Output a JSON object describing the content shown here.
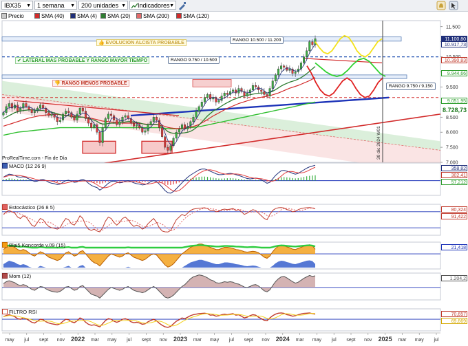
{
  "toolbar": {
    "symbol": "IBX35",
    "interval": "1 semana",
    "units": "200 unidades",
    "indicators": "Indicadores",
    "arrow_down": "▼",
    "trend_icon": "trend-icon",
    "draw_icon": "draw-icon",
    "cursor_icon": "cursor-icon",
    "alert_icon": "bell-icon"
  },
  "legend": [
    {
      "label": "Precio",
      "color": "#c8c8c8"
    },
    {
      "label": "SMA (40)",
      "color": "#d22b2b"
    },
    {
      "label": "SMA (4)",
      "color": "#1f2f7a"
    },
    {
      "label": "SMA (20)",
      "color": "#2f7d32"
    },
    {
      "label": "SMA (200)",
      "color": "#e36b6b"
    },
    {
      "label": "SMA (120)",
      "color": "#d22b2b"
    }
  ],
  "annotations": {
    "bull": "EVOLUCION ALCISTA PROBABLE",
    "lateral": "LATERAL MAS PROBABLE Y RANGO MAYOR TIEMPO",
    "bear": "RANGO MENOS PROBABLE",
    "range1": "RANGO 10.500 / 11.200",
    "range2": "RANGO 9.750 / 10.500",
    "range3": "RANGO 9.750 / 9.150",
    "vline_date": "30 dic 2024 W01",
    "source": "ProRealTime.com - Fin de Día"
  },
  "chart_data": [
    {
      "type": "line",
      "name": "price",
      "ylim": [
        7000,
        11700
      ],
      "yticks": [
        "11.500",
        "11.000",
        "10.500",
        "10.000",
        "9.500",
        "9.000",
        "8.500",
        "8.000",
        "7.500",
        "7.000"
      ],
      "price_tags": [
        {
          "label": "11.100,80",
          "value": 11100,
          "bg": "#1f2f7a",
          "fg": "#ffffff"
        },
        {
          "label": "10.917,73",
          "value": 10917,
          "bg": "#ffffff",
          "fg": "#1f2f7a"
        },
        {
          "label": "10.390,83",
          "value": 10390,
          "bg": "#ffffff",
          "fg": "#c0392b"
        },
        {
          "label": "9.944,66",
          "value": 9944,
          "bg": "#ffffff",
          "fg": "#2e9e2e"
        },
        {
          "label": "9.051,95",
          "value": 9051,
          "bg": "#ffffff",
          "fg": "#2e9e2e"
        },
        {
          "label": "8.728,73",
          "value": 8728,
          "bg": "#ffffff",
          "fg": "#1f7a1f"
        }
      ],
      "x_labels": [
        "may",
        "jul",
        "sept",
        "nov",
        "2022",
        "mar",
        "may",
        "jul",
        "sept",
        "nov",
        "2023",
        "mar",
        "may",
        "jul",
        "sept",
        "nov",
        "2024",
        "mar",
        "may",
        "jul",
        "sept",
        "nov",
        "2025",
        "mar",
        "may",
        "jul"
      ],
      "close": [
        8650,
        8850,
        8950,
        8800,
        8900,
        8700,
        8800,
        8950,
        8850,
        8750,
        8650,
        8700,
        8800,
        8900,
        8800,
        8650,
        8550,
        8600,
        8500,
        8350,
        8400,
        8600,
        8700,
        8650,
        8500,
        8400,
        8600,
        8800,
        8700,
        8450,
        8300,
        8150,
        8250,
        8000,
        7650,
        8150,
        8450,
        8600,
        8550,
        8400,
        8250,
        8350,
        8500,
        8550,
        8450,
        8300,
        8200,
        8250,
        8150,
        8000,
        8050,
        8250,
        8350,
        8500,
        8400,
        8150,
        7850,
        7500,
        7400,
        7550,
        7800,
        8000,
        8100,
        8250,
        8100,
        8200,
        8350,
        8500,
        8700,
        8850,
        9000,
        9150,
        9250,
        9100,
        9150,
        9000,
        9050,
        9200,
        9300,
        9250,
        9350,
        9400,
        9300,
        9450,
        9350,
        9200,
        9300,
        9400,
        9550,
        9500,
        9400,
        9350,
        9250,
        9200,
        9450,
        9700,
        9900,
        10100,
        10200,
        10150,
        10050,
        10100,
        9950,
        10000,
        10100,
        10300,
        10500,
        10700,
        11000,
        10900,
        11100
      ],
      "sma20": [
        8450,
        8500,
        8550,
        8600,
        8650,
        8680,
        8700,
        8720,
        8730,
        8740,
        8740,
        8730,
        8720,
        8720,
        8720,
        8700,
        8680,
        8660,
        8640,
        8610,
        8580,
        8560,
        8550,
        8540,
        8520,
        8500,
        8500,
        8500,
        8500,
        8480,
        8450,
        8420,
        8400,
        8360,
        8300,
        8270,
        8270,
        8290,
        8300,
        8300,
        8300,
        8310,
        8320,
        8340,
        8350,
        8350,
        8340,
        8330,
        8310,
        8280,
        8260,
        8250,
        8250,
        8260,
        8260,
        8230,
        8180,
        8100,
        8020,
        7980,
        7960,
        7950,
        7950,
        7970,
        7980,
        8000,
        8030,
        8080,
        8150,
        8240,
        8340,
        8440,
        8540,
        8620,
        8700,
        8760,
        8810,
        8870,
        8930,
        8980,
        9030,
        9080,
        9110,
        9150,
        9180,
        9200,
        9220,
        9240,
        9260,
        9280,
        9290,
        9300,
        9300,
        9300,
        9320,
        9360,
        9410,
        9470,
        9530,
        9580,
        9620,
        9660,
        9690,
        9720,
        9760,
        9810,
        9870,
        9940,
        10020,
        10100,
        10180
      ],
      "sma40": [
        8200,
        8230,
        8260,
        8290,
        8320,
        8350,
        8380,
        8410,
        8440,
        8470,
        8490,
        8510,
        8530,
        8550,
        8560,
        8570,
        8580,
        8590,
        8590,
        8590,
        8580,
        8570,
        8560,
        8550,
        8540,
        8530,
        8520,
        8510,
        8500,
        8490,
        8480,
        8460,
        8440,
        8420,
        8390,
        8370,
        8360,
        8350,
        8340,
        8330,
        8320,
        8310,
        8300,
        8300,
        8300,
        8300,
        8300,
        8300,
        8290,
        8280,
        8270,
        8260,
        8250,
        8250,
        8250,
        8240,
        8220,
        8190,
        8160,
        8140,
        8130,
        8120,
        8120,
        8130,
        8140,
        8150,
        8170,
        8190,
        8220,
        8260,
        8310,
        8360,
        8420,
        8480,
        8540,
        8590,
        8640,
        8690,
        8740,
        8790,
        8830,
        8870,
        8910,
        8950,
        8980,
        9010,
        9040,
        9070,
        9100,
        9120,
        9140,
        9160,
        9180,
        9190,
        9210,
        9240,
        9270,
        9300,
        9340,
        9380,
        9420,
        9460,
        9490,
        9520,
        9550,
        9590,
        9630,
        9670,
        9710,
        9760,
        9810
      ],
      "sma120": [
        7900,
        7920,
        7940,
        7960,
        7980,
        8000,
        8010,
        8020,
        8030,
        8040,
        8050,
        8060,
        8070,
        8080,
        8090,
        8100,
        8110,
        8120,
        8130,
        8140,
        8150,
        8150,
        8150,
        8150,
        8150,
        8150,
        8150,
        8150,
        8150,
        8150,
        8150,
        8150,
        8150,
        8150,
        8150,
        8150,
        8150,
        8150,
        8150,
        8150,
        8150,
        8150,
        8150,
        8150,
        8150,
        8150,
        8150,
        8150,
        8150,
        8150,
        8150,
        8150,
        8150,
        8150,
        8150,
        8150,
        8140,
        8130,
        8120,
        8110,
        8110,
        8110,
        8110,
        8120,
        8130,
        8140,
        8150,
        8160,
        8170,
        8180,
        8200,
        8220,
        8240,
        8260,
        8280,
        8300,
        8320,
        8340,
        8360,
        8380,
        8400,
        8420,
        8440,
        8460,
        8480,
        8500,
        8520,
        8540,
        8560,
        8580,
        8600,
        8620,
        8640,
        8660,
        8680,
        8700,
        8720,
        8740,
        8760,
        8780,
        8800,
        8820,
        8840,
        8860,
        8880,
        8900,
        8920,
        8940,
        8960,
        8980,
        9000
      ],
      "proj_yellow": [
        11000,
        10800,
        10650,
        10600,
        10700,
        10900,
        11100,
        11200,
        11150,
        10950,
        10700,
        10550,
        10500,
        10600,
        10800,
        11000,
        11100
      ],
      "proj_green": [
        10300,
        10150,
        10000,
        9900,
        9850,
        9900,
        10050,
        10250,
        10400,
        10450,
        10350,
        10150,
        9950,
        9850
      ],
      "proj_red": [
        10200,
        9950,
        9650,
        9400,
        9250,
        9200,
        9300,
        9500,
        9700,
        9800,
        9700,
        9450,
        9250,
        9150,
        9200,
        9400,
        9650,
        9800
      ]
    },
    {
      "type": "line",
      "name": "MACD (12 26 9)",
      "tags": [
        "358,82",
        "302,41",
        "57,212"
      ],
      "values": [
        80,
        120,
        150,
        140,
        120,
        90,
        80,
        90,
        70,
        40,
        10,
        -20,
        -10,
        20,
        30,
        0,
        -40,
        -60,
        -70,
        -90,
        -80,
        -40,
        0,
        10,
        -10,
        -40,
        -30,
        10,
        30,
        0,
        -60,
        -110,
        -140,
        -160,
        -220,
        -180,
        -120,
        -60,
        -20,
        -10,
        -30,
        -50,
        -40,
        -10,
        0,
        -20,
        -50,
        -70,
        -80,
        -100,
        -90,
        -60,
        -20,
        0,
        -20,
        -80,
        -150,
        -230,
        -280,
        -290,
        -250,
        -190,
        -120,
        -50,
        20,
        80,
        130,
        170,
        210,
        250,
        270,
        270,
        250,
        220,
        190,
        160,
        140,
        140,
        150,
        160,
        170,
        160,
        140,
        120,
        100,
        70,
        50,
        40,
        50,
        60,
        50,
        20,
        -20,
        -60,
        -40,
        40,
        120,
        180,
        230,
        240,
        220,
        200,
        170,
        150,
        170,
        210,
        250,
        290,
        320,
        340,
        358
      ]
    },
    {
      "type": "line",
      "name": "Estocástico (26 8 5)",
      "tags": [
        "80,324",
        "91,422"
      ],
      "values": [
        70,
        80,
        85,
        80,
        75,
        60,
        55,
        65,
        60,
        45,
        30,
        25,
        40,
        55,
        50,
        35,
        25,
        20,
        18,
        15,
        20,
        40,
        55,
        50,
        35,
        30,
        45,
        65,
        55,
        30,
        15,
        10,
        15,
        8,
        5,
        20,
        45,
        60,
        55,
        40,
        30,
        40,
        55,
        60,
        50,
        35,
        25,
        30,
        25,
        15,
        20,
        35,
        45,
        55,
        40,
        20,
        8,
        5,
        4,
        10,
        30,
        50,
        60,
        70,
        65,
        75,
        85,
        90,
        92,
        93,
        94,
        95,
        92,
        85,
        86,
        80,
        82,
        88,
        90,
        88,
        90,
        92,
        85,
        88,
        80,
        70,
        75,
        82,
        88,
        85,
        75,
        65,
        55,
        50,
        70,
        85,
        92,
        95,
        96,
        94,
        88,
        86,
        80,
        82,
        88,
        92,
        94,
        95,
        96,
        94,
        91
      ]
    },
    {
      "type": "area",
      "name": "Blai5 Koncorde v.09 (15)",
      "tags": [
        "21,418"
      ],
      "values": [
        20,
        30,
        40,
        35,
        30,
        20,
        15,
        20,
        15,
        5,
        -5,
        -10,
        0,
        10,
        5,
        -5,
        -15,
        -20,
        -25,
        -30,
        -25,
        -10,
        5,
        10,
        0,
        -10,
        -5,
        10,
        15,
        0,
        -15,
        -30,
        -40,
        -45,
        -55,
        -40,
        -25,
        -10,
        0,
        -5,
        -10,
        -15,
        -10,
        0,
        5,
        -5,
        -15,
        -20,
        -25,
        -30,
        -25,
        -15,
        -5,
        0,
        -5,
        -20,
        -35,
        -50,
        -60,
        -55,
        -45,
        -30,
        -15,
        0,
        10,
        20,
        30,
        35,
        40,
        45,
        45,
        40,
        35,
        30,
        25,
        20,
        20,
        25,
        30,
        30,
        28,
        25,
        20,
        18,
        15,
        10,
        8,
        10,
        12,
        10,
        5,
        -5,
        -15,
        -20,
        -10,
        10,
        25,
        35,
        40,
        38,
        32,
        28,
        22,
        20,
        25,
        30,
        35,
        40,
        42,
        38,
        21
      ]
    },
    {
      "type": "area",
      "name": "Mom (12)",
      "tags": [
        "1.204,2"
      ],
      "values": [
        400,
        600,
        700,
        600,
        500,
        300,
        200,
        300,
        200,
        0,
        -200,
        -300,
        -100,
        100,
        50,
        -150,
        -300,
        -400,
        -450,
        -500,
        -400,
        -200,
        50,
        100,
        -100,
        -300,
        -200,
        100,
        200,
        -100,
        -400,
        -700,
        -800,
        -900,
        -1100,
        -800,
        -500,
        -200,
        0,
        -100,
        -200,
        -300,
        -200,
        0,
        100,
        -100,
        -300,
        -400,
        -450,
        -550,
        -450,
        -250,
        -50,
        100,
        -100,
        -400,
        -700,
        -1000,
        -1100,
        -1000,
        -800,
        -500,
        -200,
        100,
        300,
        600,
        900,
        1100,
        1200,
        1300,
        1250,
        1150,
        1000,
        800,
        700,
        500,
        450,
        500,
        600,
        550,
        600,
        550,
        400,
        350,
        200,
        50,
        0,
        100,
        250,
        300,
        150,
        -100,
        -350,
        -450,
        -250,
        200,
        600,
        900,
        1100,
        1150,
        1000,
        800,
        600,
        450,
        550,
        750,
        950,
        1100,
        1250,
        1150,
        1204
      ]
    },
    {
      "type": "line",
      "name": "FILTRO RSI",
      "tags": [
        "70,657",
        "69,669"
      ],
      "values": [
        60,
        65,
        68,
        64,
        60,
        52,
        50,
        55,
        52,
        45,
        38,
        35,
        42,
        50,
        48,
        40,
        35,
        32,
        30,
        28,
        32,
        42,
        50,
        48,
        40,
        36,
        44,
        55,
        50,
        38,
        30,
        26,
        28,
        24,
        20,
        32,
        45,
        52,
        50,
        42,
        38,
        42,
        50,
        52,
        48,
        40,
        36,
        38,
        35,
        30,
        32,
        40,
        45,
        50,
        44,
        34,
        26,
        20,
        18,
        22,
        32,
        42,
        48,
        55,
        52,
        58,
        64,
        68,
        70,
        72,
        73,
        74,
        72,
        66,
        67,
        62,
        64,
        68,
        70,
        68,
        70,
        72,
        66,
        68,
        62,
        55,
        58,
        64,
        68,
        66,
        58,
        52,
        46,
        44,
        55,
        64,
        70,
        74,
        75,
        73,
        68,
        66,
        62,
        64,
        68,
        71,
        73,
        74,
        75,
        72,
        70
      ]
    }
  ]
}
